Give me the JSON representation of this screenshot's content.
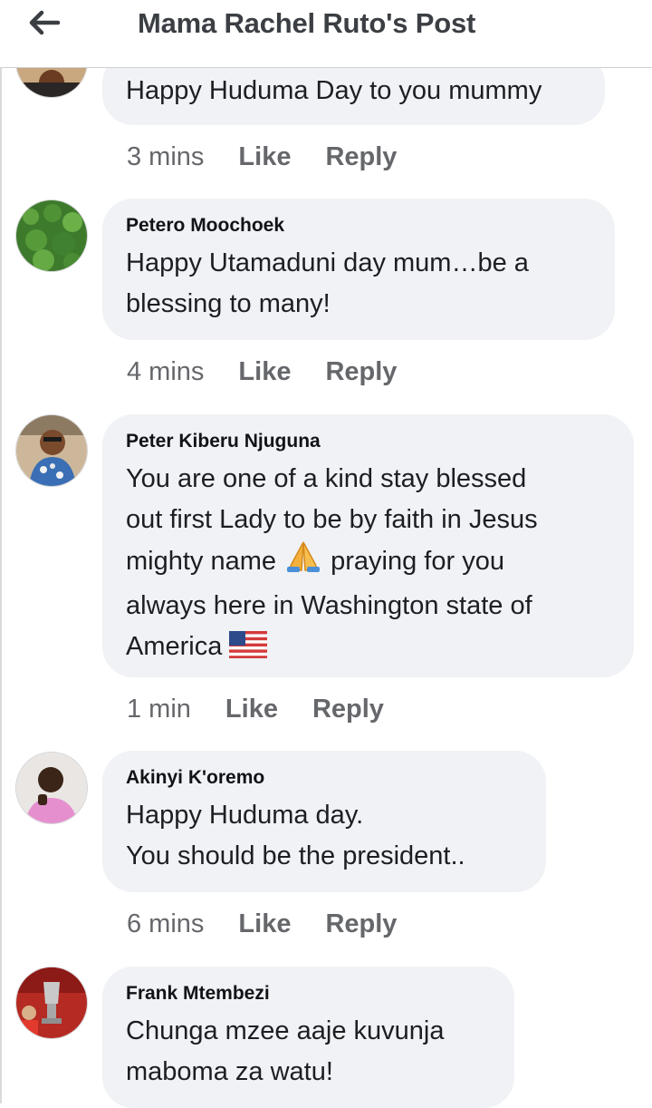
{
  "header": {
    "title": "Mama Rachel Ruto's Post",
    "back_icon": "arrow-left-icon"
  },
  "colors": {
    "bubble_background": "#f0f2f5",
    "meta_text": "#65676b",
    "header_text": "#3b3f44"
  },
  "comments": [
    {
      "author": "",
      "text": "Happy Huduma Day to you mummy",
      "time": "3 mins",
      "like_label": "Like",
      "reply_label": "Reply"
    },
    {
      "author": "Petero Moochoek",
      "text_line1": "Happy Utamaduni day mum…be a",
      "text_line2": "blessing to many!",
      "time": "4 mins",
      "like_label": "Like",
      "reply_label": "Reply"
    },
    {
      "author": "Peter Kiberu Njuguna",
      "text_line1": "You are one of a kind stay blessed",
      "text_line2": "out first Lady to be by faith in Jesus",
      "text_line3a": "mighty name",
      "text_line3b": "praying for you",
      "text_line4": "always here in Washington state of",
      "text_line5": "America",
      "emoji_1": "folded-hands-emoji",
      "emoji_2": "us-flag-emoji",
      "time": "1 min",
      "like_label": "Like",
      "reply_label": "Reply"
    },
    {
      "author": "Akinyi K'oremo",
      "text_line1": "Happy Huduma day.",
      "text_line2": "You should be the president..",
      "time": "6 mins",
      "like_label": "Like",
      "reply_label": "Reply"
    },
    {
      "author": "Frank Mtembezi",
      "text_line1": "Chunga mzee aaje kuvunja",
      "text_line2": "maboma za watu!"
    }
  ]
}
